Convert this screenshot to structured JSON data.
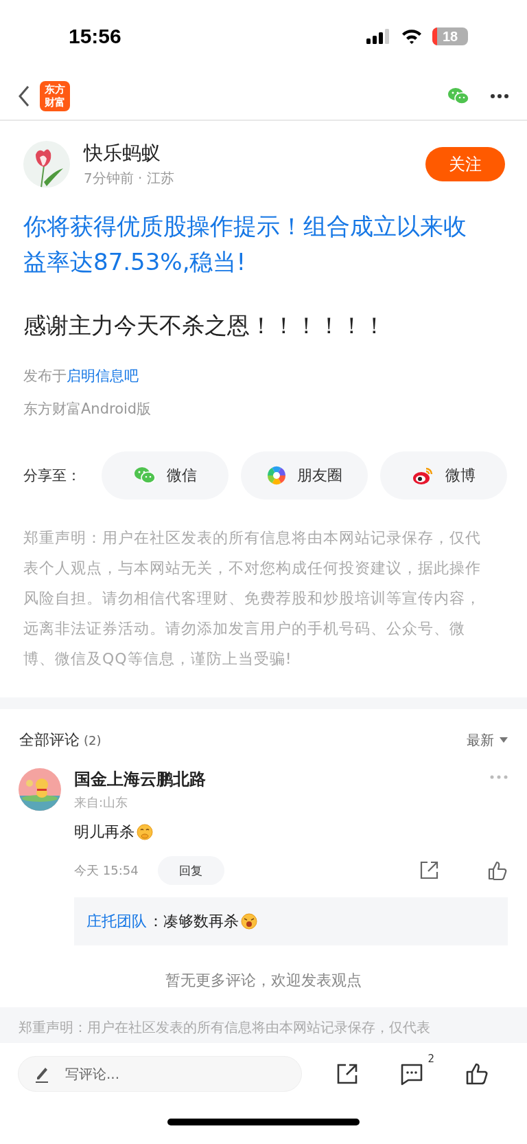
{
  "status_bar": {
    "time": "15:56",
    "battery": "18"
  },
  "header": {
    "logo": "东方财富"
  },
  "post": {
    "author": "快乐蚂蚁",
    "meta": "7分钟前 · 江苏",
    "follow": "关注",
    "promo": "你将获得优质股操作提示！组合成立以来收益率达87.53%,稳当!",
    "content": "感谢主力今天不杀之恩！！！！！！",
    "posted_in_prefix": "发布于",
    "forum": "启明信息吧",
    "client": "东方财富Android版"
  },
  "share": {
    "label": "分享至：",
    "targets": [
      {
        "kind": "wechat",
        "label": "微信"
      },
      {
        "kind": "moments",
        "label": "朋友圈"
      },
      {
        "kind": "weibo",
        "label": "微博"
      }
    ]
  },
  "disclaimer": "郑重声明：用户在社区发表的所有信息将由本网站记录保存，仅代表个人观点，与本网站无关，不对您构成任何投资建议，据此操作风险自担。请勿相信代客理财、免费荐股和炒股培训等宣传内容，远离非法证券活动。请勿添加发言用户的手机号码、公众号、微博、微信及QQ等信息，谨防上当受骗!",
  "comments": {
    "title": "全部评论",
    "count": "(2)",
    "sort": "最新",
    "items": [
      {
        "author": "国金上海云鹏北路",
        "origin": "来自:山东",
        "text": "明儿再杀",
        "emoji": {
          "kind": "giggle"
        },
        "time": "今天 15:54",
        "reply_button": "回复",
        "replies": [
          {
            "author": "庄托团队",
            "text": "：凑够数再杀",
            "emoji": {
              "kind": "yawn"
            }
          }
        ]
      }
    ],
    "end_note": "暂无更多评论，欢迎发表观点"
  },
  "footer_disclaimer": "郑重声明：用户在社区发表的所有信息将由本网站记录保存，仅代表",
  "bottom_bar": {
    "placeholder": "写评论...",
    "comment_badge": "2"
  }
}
